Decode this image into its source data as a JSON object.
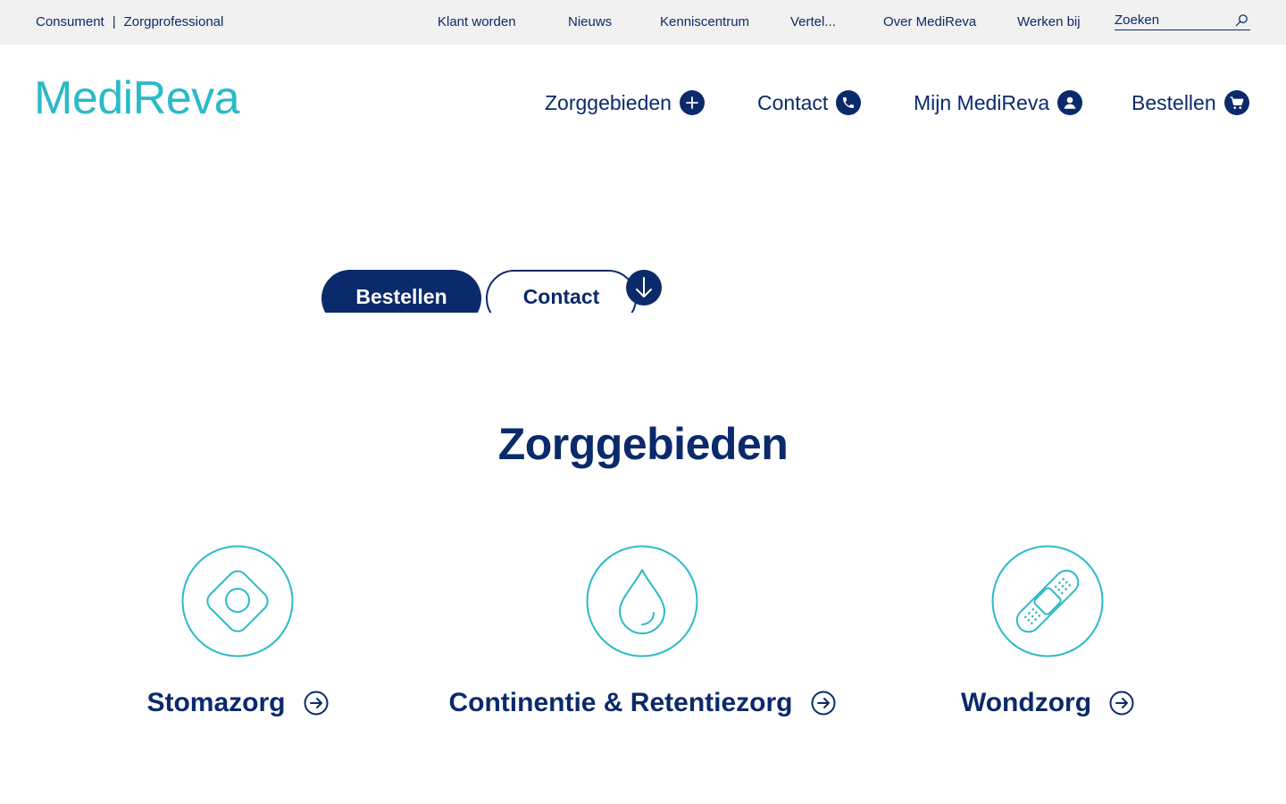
{
  "topbar": {
    "audience": [
      "Consument",
      "Zorgprofessional"
    ],
    "separator": "|",
    "links": [
      "Klant worden",
      "Nieuws",
      "Kenniscentrum",
      "Vertel...",
      "Over MediReva",
      "Werken bij"
    ],
    "search_placeholder": "Zoeken"
  },
  "header": {
    "logo": "MediReva",
    "nav": [
      {
        "label": "Zorggebieden",
        "icon": "plus-icon"
      },
      {
        "label": "Contact",
        "icon": "phone-icon"
      },
      {
        "label": "Mijn MediReva",
        "icon": "user-icon"
      },
      {
        "label": "Bestellen",
        "icon": "cart-icon"
      }
    ]
  },
  "hero": {
    "primary_button": "Bestellen",
    "secondary_button": "Contact"
  },
  "section": {
    "title": "Zorggebieden",
    "cards": [
      {
        "label": "Stomazorg",
        "icon": "stoma-icon"
      },
      {
        "label": "Continentie & Retentiezorg",
        "icon": "drop-icon"
      },
      {
        "label": "Wondzorg",
        "icon": "bandage-icon"
      }
    ]
  },
  "colors": {
    "navy": "#0b2a6b",
    "teal": "#2bbac8",
    "topbar_bg": "#f1f1f1"
  }
}
